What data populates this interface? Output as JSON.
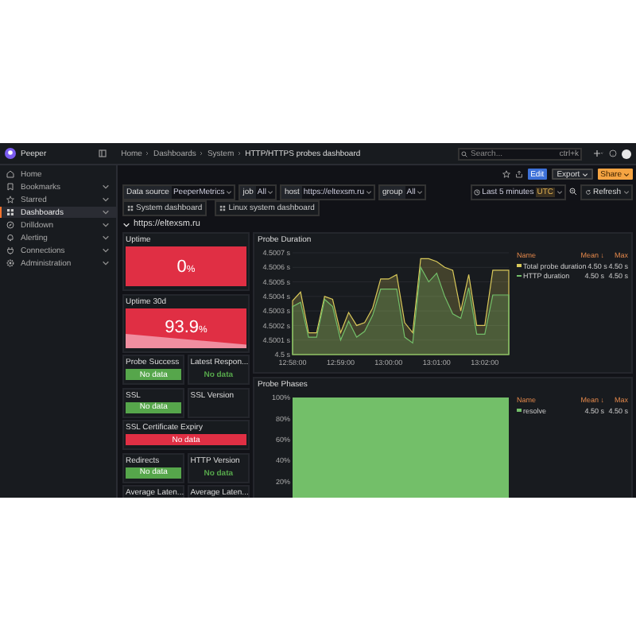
{
  "topbar": {
    "logo_text": "Peeper",
    "breadcrumbs": [
      "Home",
      "Dashboards",
      "System",
      "HTTP/HTTPS probes dashboard"
    ],
    "search": {
      "placeholder": "Search...",
      "shortcut": "ctrl+k"
    }
  },
  "toolbar": {
    "buttons": [
      {
        "label": "Edit",
        "kind": "secondary",
        "caret": false
      },
      {
        "label": "Export",
        "kind": "outline",
        "caret": true
      },
      {
        "label": "Share",
        "kind": "primary",
        "caret": true
      }
    ]
  },
  "sidebar": {
    "items": [
      {
        "label": "Home",
        "selected": false,
        "expandable": false
      },
      {
        "label": "Bookmarks",
        "selected": false,
        "expandable": true
      },
      {
        "label": "Starred",
        "selected": false,
        "expandable": true
      },
      {
        "label": "Dashboards",
        "selected": true,
        "expandable": true
      },
      {
        "label": "Drilldown",
        "selected": false,
        "expandable": true
      },
      {
        "label": "Alerting",
        "selected": false,
        "expandable": true
      },
      {
        "label": "Connections",
        "selected": false,
        "expandable": true
      },
      {
        "label": "Administration",
        "selected": false,
        "expandable": true
      }
    ]
  },
  "variables": [
    {
      "label": "Data source",
      "value": "PeeperMetrics"
    },
    {
      "label": "job",
      "value": "All"
    },
    {
      "label": "host",
      "value": "https://eltexsm.ru"
    },
    {
      "label": "group",
      "value": "All"
    }
  ],
  "time_range": {
    "label": "Last 5 minutes",
    "timezone": "UTC"
  },
  "refresh": {
    "label": "Refresh"
  },
  "links": [
    "System dashboard",
    "Linux system dashboard"
  ],
  "row": {
    "title": "https://eltexsm.ru",
    "expanded": true
  },
  "stat_rows": [
    [
      {
        "title": "Uptime",
        "value": "0",
        "unit": "%",
        "kind": "background",
        "color": "#e02f44"
      }
    ],
    [
      {
        "title": "Uptime 30d",
        "value": "93.9",
        "unit": "%",
        "kind": "background-sparkline",
        "color": "#e02f44"
      }
    ],
    [
      {
        "title": "Probe Success",
        "value": "No data",
        "kind": "background",
        "color": "#56a64b"
      },
      {
        "title": "Latest Respon...",
        "value": "No data",
        "kind": "text",
        "color": "#56a64b"
      }
    ],
    [
      {
        "title": "SSL",
        "value": "No data",
        "kind": "background",
        "color": "#56a64b"
      },
      {
        "title": "SSL Version",
        "kind": "empty"
      }
    ],
    [
      {
        "title": "SSL Certificate Expiry",
        "value": "No data",
        "kind": "background",
        "color": "#e02f44"
      }
    ],
    [
      {
        "title": "Redirects",
        "value": "No data",
        "kind": "background",
        "color": "#56a64b"
      },
      {
        "title": "HTTP Version",
        "value": "No data",
        "kind": "text",
        "color": "#56a64b"
      }
    ],
    [
      {
        "title": "Average Laten...",
        "kind": "empty"
      },
      {
        "title": "Average Laten...",
        "kind": "empty"
      }
    ]
  ],
  "probe_duration": {
    "title": "Probe Duration",
    "legend": {
      "columns": [
        "Name",
        "Mean ↓",
        "Max"
      ],
      "rows": [
        {
          "mean": "4.50 s",
          "max": "4.50 s"
        },
        {
          "mean": "4.50 s",
          "max": "4.50 s"
        }
      ]
    },
    "chart_data": {
      "type": "area",
      "grid": true,
      "categories": [
        "12:58:00",
        null,
        null,
        null,
        null,
        null,
        "12:59:00",
        null,
        null,
        null,
        null,
        null,
        "13:00:00",
        null,
        null,
        null,
        null,
        null,
        "13:01:00",
        null,
        null,
        null,
        null,
        null,
        "13:02:00",
        null,
        null,
        null
      ],
      "series": [
        {
          "name": "Total probe duration",
          "color": "#d9c95a",
          "values": [
            4.50037,
            4.50043,
            4.50015,
            4.50015,
            4.5004,
            4.50038,
            4.50015,
            4.50029,
            4.5002,
            4.50022,
            4.50032,
            4.50052,
            4.50052,
            4.50055,
            4.50022,
            4.50015,
            4.50066,
            4.50066,
            4.50064,
            4.5006,
            4.50058,
            4.5003,
            4.50055,
            4.5002,
            4.5002,
            4.50058,
            4.50058,
            4.50058
          ]
        },
        {
          "name": "HTTP duration",
          "color": "#73bf69",
          "values": [
            4.50033,
            4.50036,
            4.50012,
            4.50012,
            4.50038,
            4.50033,
            4.5001,
            4.50023,
            4.50012,
            4.50016,
            4.50027,
            4.50045,
            4.50045,
            4.50045,
            4.50012,
            4.50008,
            4.5006,
            4.5005,
            4.50056,
            4.5004,
            4.50028,
            4.50025,
            4.50046,
            4.50014,
            4.50014,
            4.50041,
            4.50041,
            4.50041
          ]
        }
      ],
      "ylim": [
        4.5,
        4.5007
      ],
      "yticks": [
        {
          "value": 4.5007,
          "label": "4.5007 s"
        },
        {
          "value": 4.5006,
          "label": "4.5006 s"
        },
        {
          "value": 4.5005,
          "label": "4.5005 s"
        },
        {
          "value": 4.5004,
          "label": "4.5004 s"
        },
        {
          "value": 4.5003,
          "label": "4.5003 s"
        },
        {
          "value": 4.5002,
          "label": "4.5002 s"
        },
        {
          "value": 4.5001,
          "label": "4.5001 s"
        },
        {
          "value": 4.5,
          "label": "4.5 s"
        }
      ]
    }
  },
  "probe_phases": {
    "title": "Probe Phases",
    "legend": {
      "columns": [
        "Name",
        "Mean ↓",
        "Max"
      ],
      "rows": [
        {
          "name": "resolve",
          "color": "#73bf69",
          "mean": "4.50 s",
          "max": "4.50 s"
        }
      ]
    },
    "y_axis_labels": [
      "100%",
      "80%",
      "60%",
      "40%",
      "20%"
    ]
  }
}
